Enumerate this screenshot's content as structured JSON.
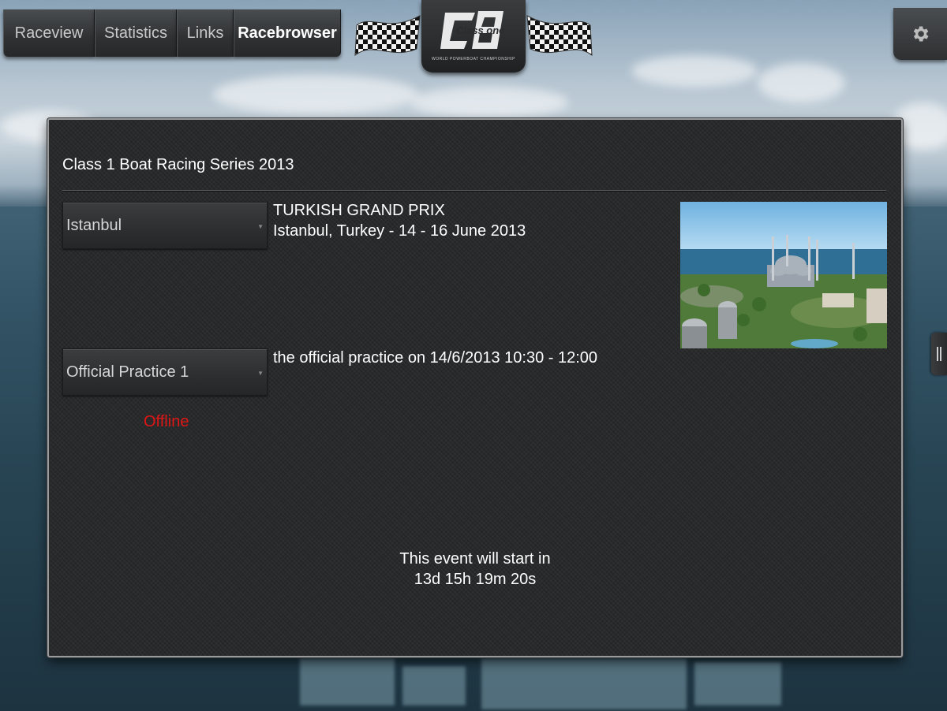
{
  "nav": {
    "tabs": [
      {
        "label": "Raceview",
        "active": false
      },
      {
        "label": "Statistics",
        "active": false
      },
      {
        "label": "Links",
        "active": false
      },
      {
        "label": "Racebrowser",
        "active": true
      }
    ]
  },
  "brand": {
    "logo_text": "Class one",
    "logo_sub": "WORLD POWERBOAT CHAMPIONSHIP"
  },
  "settings_icon": "gear-icon",
  "panel": {
    "title": "Class 1 Boat Racing Series 2013",
    "race_selector": {
      "value": "Istanbul"
    },
    "event": {
      "name": "TURKISH GRAND PRIX",
      "location_dates": "Istanbul, Turkey - 14  - 16 June 2013"
    },
    "session_selector": {
      "value": "Official Practice 1"
    },
    "session_description": "the official practice on 14/6/2013 10:30 - 12:00",
    "status": "Offline",
    "countdown": {
      "label": "This event will start in",
      "value": "13d 15h 19m 20s"
    }
  },
  "colors": {
    "status_offline": "#e01616",
    "panel_bg": "#262728"
  }
}
